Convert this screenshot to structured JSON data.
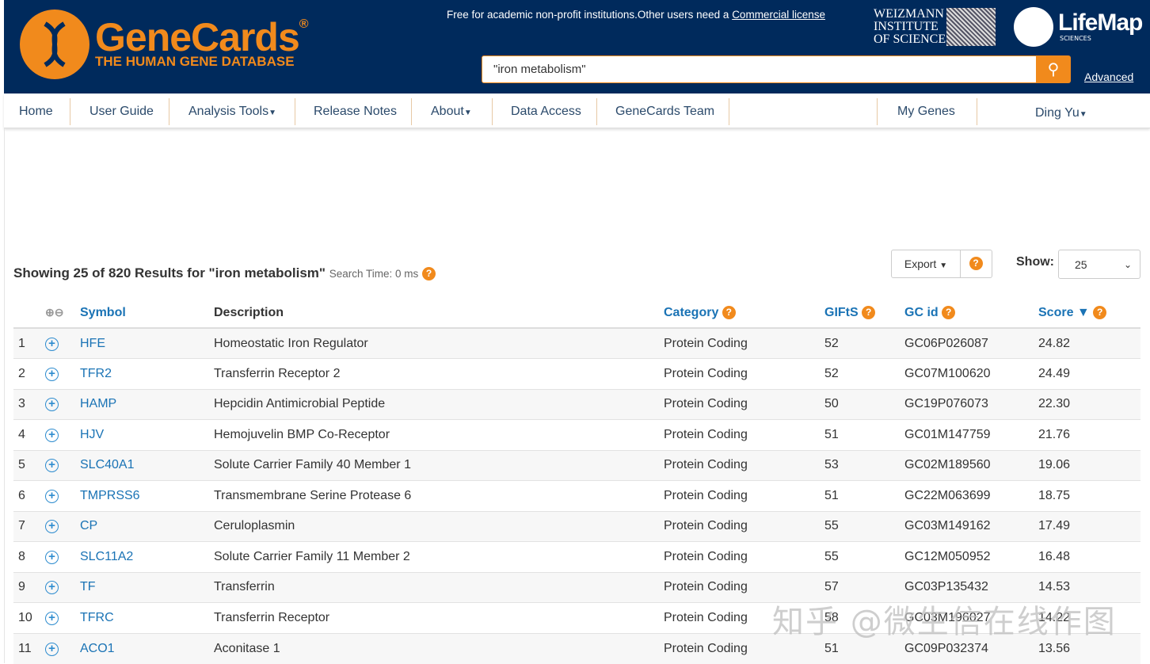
{
  "header": {
    "brand": "GeneCards",
    "reg": "®",
    "tagline": "THE HUMAN GENE DATABASE",
    "free_text": "Free for academic non-profit institutions.Other users need a ",
    "commercial_link": "Commercial license",
    "weizmann": [
      "WEIZMANN",
      "INSTITUTE",
      "OF SCIENCE"
    ],
    "lifemap": "LifeMap",
    "lifemap_sub": "SCIENCES",
    "search_value": "\"iron metabolism\"",
    "advanced": "Advanced"
  },
  "nav": {
    "items": [
      "Home",
      "User Guide",
      "Analysis Tools",
      "Release Notes",
      "About",
      "Data Access",
      "GeneCards Team",
      "My Genes",
      "Ding Yu"
    ]
  },
  "results": {
    "summary": "Showing 25 of 820 Results for \"iron metabolism\"",
    "search_time": "Search Time: 0 ms",
    "export": "Export",
    "show_label": "Show:",
    "show_value": "25"
  },
  "table": {
    "headers": [
      "Symbol",
      "Description",
      "Category",
      "GIFtS",
      "GC id",
      "Score"
    ],
    "rows": [
      [
        "1",
        "HFE",
        "Homeostatic Iron Regulator",
        "Protein Coding",
        "52",
        "GC06P026087",
        "24.82"
      ],
      [
        "2",
        "TFR2",
        "Transferrin Receptor 2",
        "Protein Coding",
        "52",
        "GC07M100620",
        "24.49"
      ],
      [
        "3",
        "HAMP",
        "Hepcidin Antimicrobial Peptide",
        "Protein Coding",
        "50",
        "GC19P076073",
        "22.30"
      ],
      [
        "4",
        "HJV",
        "Hemojuvelin BMP Co-Receptor",
        "Protein Coding",
        "51",
        "GC01M147759",
        "21.76"
      ],
      [
        "5",
        "SLC40A1",
        "Solute Carrier Family 40 Member 1",
        "Protein Coding",
        "53",
        "GC02M189560",
        "19.06"
      ],
      [
        "6",
        "TMPRSS6",
        "Transmembrane Serine Protease 6",
        "Protein Coding",
        "51",
        "GC22M063699",
        "18.75"
      ],
      [
        "7",
        "CP",
        "Ceruloplasmin",
        "Protein Coding",
        "55",
        "GC03M149162",
        "17.49"
      ],
      [
        "8",
        "SLC11A2",
        "Solute Carrier Family 11 Member 2",
        "Protein Coding",
        "55",
        "GC12M050952",
        "16.48"
      ],
      [
        "9",
        "TF",
        "Transferrin",
        "Protein Coding",
        "57",
        "GC03P135432",
        "14.53"
      ],
      [
        "10",
        "TFRC",
        "Transferrin Receptor",
        "Protein Coding",
        "58",
        "GC03M196027",
        "14.22"
      ],
      [
        "11",
        "ACO1",
        "Aconitase 1",
        "Protein Coding",
        "51",
        "GC09P032374",
        "13.56"
      ]
    ]
  },
  "watermark": "知乎 @微生信在线作图",
  "colors": {
    "header_bg": "#002a5c",
    "accent": "#f18a1c",
    "link": "#1a73b5"
  }
}
